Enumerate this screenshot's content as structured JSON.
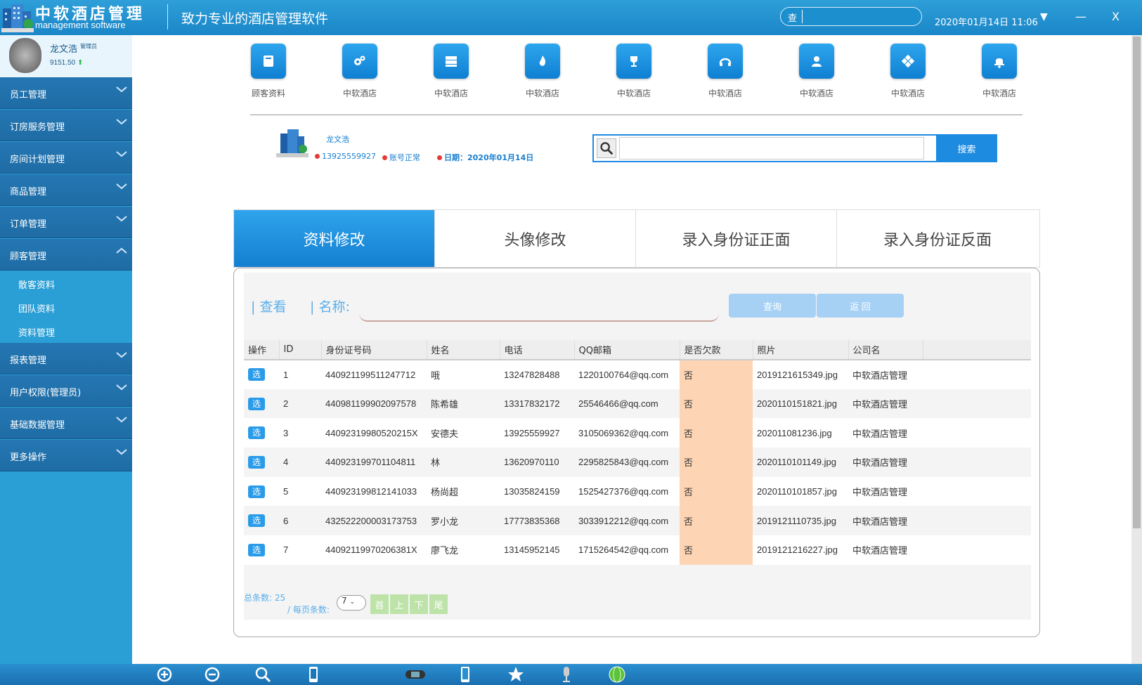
{
  "app": {
    "title": "中软酒店管理",
    "subtitle": "management software",
    "slogan": "致力专业的酒店管理软件",
    "search_label": "查",
    "search_value": "",
    "datetime": "2020年01月14日 11:06",
    "dropdown": "▼",
    "minimize": "—",
    "close": "X"
  },
  "user": {
    "name": "龙文浩",
    "role": "管理员",
    "balance": "9151.50",
    "balance_arrow": "⬆"
  },
  "nav": [
    {
      "label": "员工管理"
    },
    {
      "label": "订房服务管理"
    },
    {
      "label": "房间计划管理"
    },
    {
      "label": "商品管理"
    },
    {
      "label": "订单管理"
    },
    {
      "label": "顾客管理"
    }
  ],
  "subnav": [
    {
      "label": "散客资料"
    },
    {
      "label": "团队资料"
    },
    {
      "label": "资料管理"
    }
  ],
  "nav_bottom": [
    {
      "label": "报表管理"
    },
    {
      "label": "用户权限(管理员)"
    },
    {
      "label": "基础数据管理"
    },
    {
      "label": "更多操作"
    }
  ],
  "tiles": [
    {
      "label": "顾客资料",
      "icon": "book-icon"
    },
    {
      "label": "中软酒店",
      "icon": "gears-icon"
    },
    {
      "label": "中软酒店",
      "icon": "server-icon"
    },
    {
      "label": "中软酒店",
      "icon": "flame-icon"
    },
    {
      "label": "中软酒店",
      "icon": "trophy-icon"
    },
    {
      "label": "中软酒店",
      "icon": "headphones-icon"
    },
    {
      "label": "中软酒店",
      "icon": "user-icon"
    },
    {
      "label": "中软酒店",
      "icon": "diamond-icon"
    },
    {
      "label": "中软酒店",
      "icon": "bell-icon"
    }
  ],
  "profile": {
    "name": "龙文浩",
    "phone": "13925559927",
    "status": "账号正常",
    "date": "日期：2020年01月14日"
  },
  "main_search": {
    "placeholder": "",
    "button": "搜索"
  },
  "tabs": [
    {
      "label": "资料修改"
    },
    {
      "label": "头像修改"
    },
    {
      "label": "录入身份证正面"
    },
    {
      "label": "录入身份证反面"
    }
  ],
  "query": {
    "view_label": "| 查看",
    "name_label": "| 名称:",
    "name_value": "",
    "query_button": "查询",
    "back_button": "返 回"
  },
  "table": {
    "columns": [
      "操作",
      "ID",
      "身份证号码",
      "姓名",
      "电话",
      "QQ邮箱",
      "是否欠款",
      "照片",
      "公司名"
    ],
    "select_label": "选",
    "rows": [
      {
        "id": "1",
        "idcard": "440921199511247712",
        "name": "哦",
        "phone": "13247828488",
        "qq": "1220100764@qq.com",
        "owe": "否",
        "photo": "2019121615349.jpg",
        "company": "中软酒店管理"
      },
      {
        "id": "2",
        "idcard": "440981199902097578",
        "name": "陈希雄",
        "phone": "13317832172",
        "qq": "25546466@qq.com",
        "owe": "否",
        "photo": "2020110151821.jpg",
        "company": "中软酒店管理"
      },
      {
        "id": "3",
        "idcard": "44092319980520215X",
        "name": "安德夫",
        "phone": "13925559927",
        "qq": "3105069362@qq.com",
        "owe": "否",
        "photo": "202011081236.jpg",
        "company": "中软酒店管理"
      },
      {
        "id": "4",
        "idcard": "440923199701104811",
        "name": "林",
        "phone": "13620970110",
        "qq": "2295825843@qq.com",
        "owe": "否",
        "photo": "2020110101149.jpg",
        "company": "中软酒店管理"
      },
      {
        "id": "5",
        "idcard": "440923199812141033",
        "name": "杨尚超",
        "phone": "13035824159",
        "qq": "1525427376@qq.com",
        "owe": "否",
        "photo": "2020110101857.jpg",
        "company": "中软酒店管理"
      },
      {
        "id": "6",
        "idcard": "432522200003173753",
        "name": "罗小龙",
        "phone": "17773835368",
        "qq": "3033912212@qq.com",
        "owe": "否",
        "photo": "2019121110735.jpg",
        "company": "中软酒店管理"
      },
      {
        "id": "7",
        "idcard": "44092119970206381X",
        "name": "廖飞龙",
        "phone": "13145952145",
        "qq": "1715264542@qq.com",
        "owe": "否",
        "photo": "2019121216227.jpg",
        "company": "中软酒店管理"
      }
    ]
  },
  "pager": {
    "total_label": "总条数:",
    "total": "25",
    "per_page_label": "/ 每页条数:",
    "per_page": "7",
    "first": "首",
    "prev": "上",
    "next": "下",
    "last": "尾"
  },
  "taskbar": [
    "zoom-in-icon",
    "zoom-out-icon",
    "search-icon",
    "phone-icon",
    "gamepad-icon",
    "tablet-icon",
    "star-icon",
    "microphone-icon",
    "globe-icon"
  ]
}
